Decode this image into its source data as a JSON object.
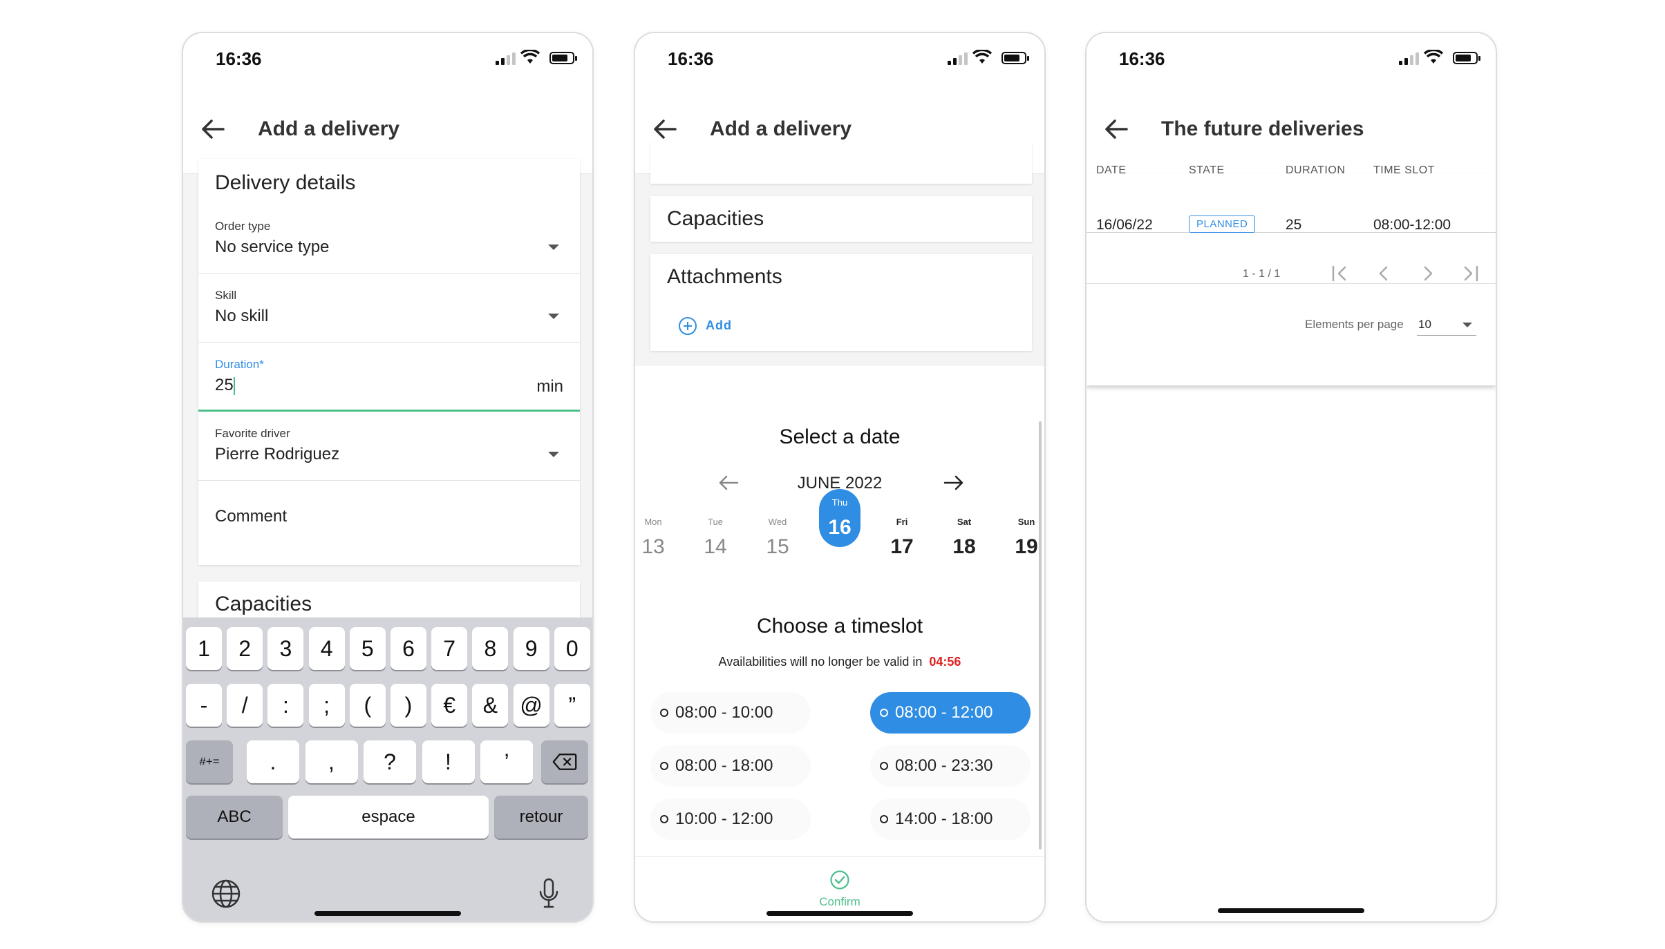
{
  "screen1": {
    "time": "16:36",
    "title": "Add a delivery",
    "section": "Delivery details",
    "order_type": {
      "label": "Order type",
      "value": "No service type"
    },
    "skill": {
      "label": "Skill",
      "value": "No skill"
    },
    "duration": {
      "label": "Duration*",
      "value": "25",
      "unit": "min"
    },
    "favorite_driver": {
      "label": "Favorite driver",
      "value": "Pierre Rodriguez"
    },
    "comment": {
      "placeholder": "Comment"
    },
    "capacities": "Capacities",
    "keyboard": {
      "row1": [
        "1",
        "2",
        "3",
        "4",
        "5",
        "6",
        "7",
        "8",
        "9",
        "0"
      ],
      "row2": [
        "-",
        "/",
        ":",
        ";",
        "(",
        ")",
        "€",
        "&",
        "@",
        "”"
      ],
      "row3": [
        ".",
        ",",
        "?",
        "!",
        "’"
      ],
      "symbols": "#+=",
      "abc": "ABC",
      "space": "espace",
      "return": "retour"
    }
  },
  "screen2": {
    "time": "16:36",
    "title": "Add a delivery",
    "capacities": "Capacities",
    "attachments": "Attachments",
    "add": "Add",
    "select_date": "Select a date",
    "month": "JUNE 2022",
    "days": [
      {
        "name": "Mon",
        "num": "13"
      },
      {
        "name": "Tue",
        "num": "14"
      },
      {
        "name": "Wed",
        "num": "15"
      },
      {
        "name": "Thu",
        "num": "16"
      },
      {
        "name": "Fri",
        "num": "17"
      },
      {
        "name": "Sat",
        "num": "18"
      },
      {
        "name": "Sun",
        "num": "19"
      }
    ],
    "choose_timeslot": "Choose a timeslot",
    "availability": "Availabilities will no longer be valid in",
    "countdown": "04:56",
    "slots": [
      "08:00 - 10:00",
      "08:00 - 12:00",
      "08:00 - 18:00",
      "08:00 - 23:30",
      "10:00 - 12:00",
      "14:00 - 18:00"
    ],
    "confirm": "Confirm"
  },
  "screen3": {
    "time": "16:36",
    "title": "The future deliveries",
    "headers": [
      "DATE",
      "STATE",
      "DURATION",
      "TIME SLOT"
    ],
    "row": {
      "date": "16/06/22",
      "state": "PLANNED",
      "duration": "25",
      "time_slot": "08:00-12:00"
    },
    "pagination": "1 - 1 / 1",
    "per_page_label": "Elements per page",
    "per_page_value": "10"
  },
  "colors": {
    "accent": "#2f8de4",
    "green": "#4cbf8b",
    "red": "#e02020"
  }
}
